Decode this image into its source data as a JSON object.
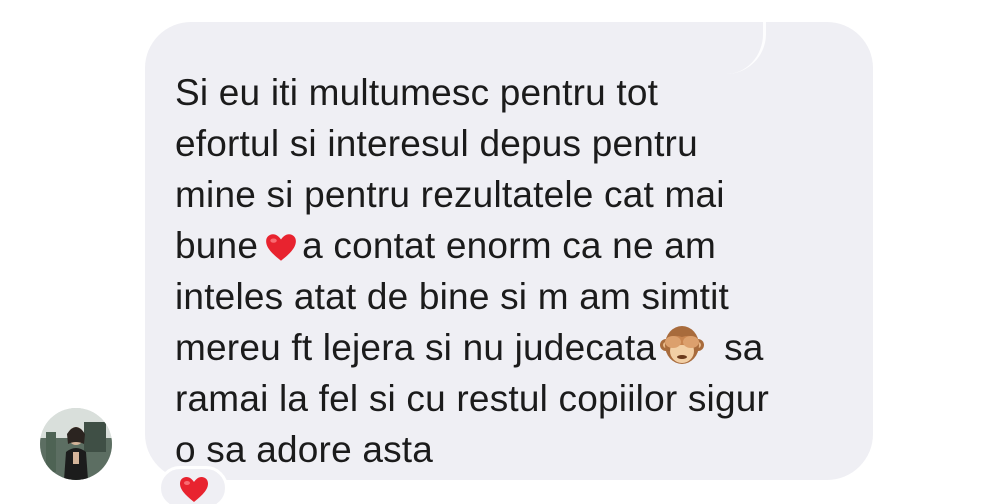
{
  "message": {
    "lines": [
      "Si eu iti multumesc pentru tot",
      "efortul si interesul depus pentru",
      "mine si pentru rezultatele cat mai",
      "bune",
      "a contat enorm ca ne am",
      "inteles atat de bine si m am simtit",
      "mereu ft lejera si nu judecata",
      "sa",
      "ramai la fel si cu restul copiilor sigur",
      "o sa adore asta"
    ],
    "inline_emoji": [
      "red-heart-icon",
      "see-no-evil-monkey-icon"
    ]
  },
  "sender": {
    "avatar": "profile-photo"
  },
  "reaction": {
    "emoji": "red-heart-icon",
    "color": "#e8232f"
  },
  "colors": {
    "bubble": "#efeff4",
    "text": "#1b1b1b",
    "heart": "#e8232f"
  }
}
